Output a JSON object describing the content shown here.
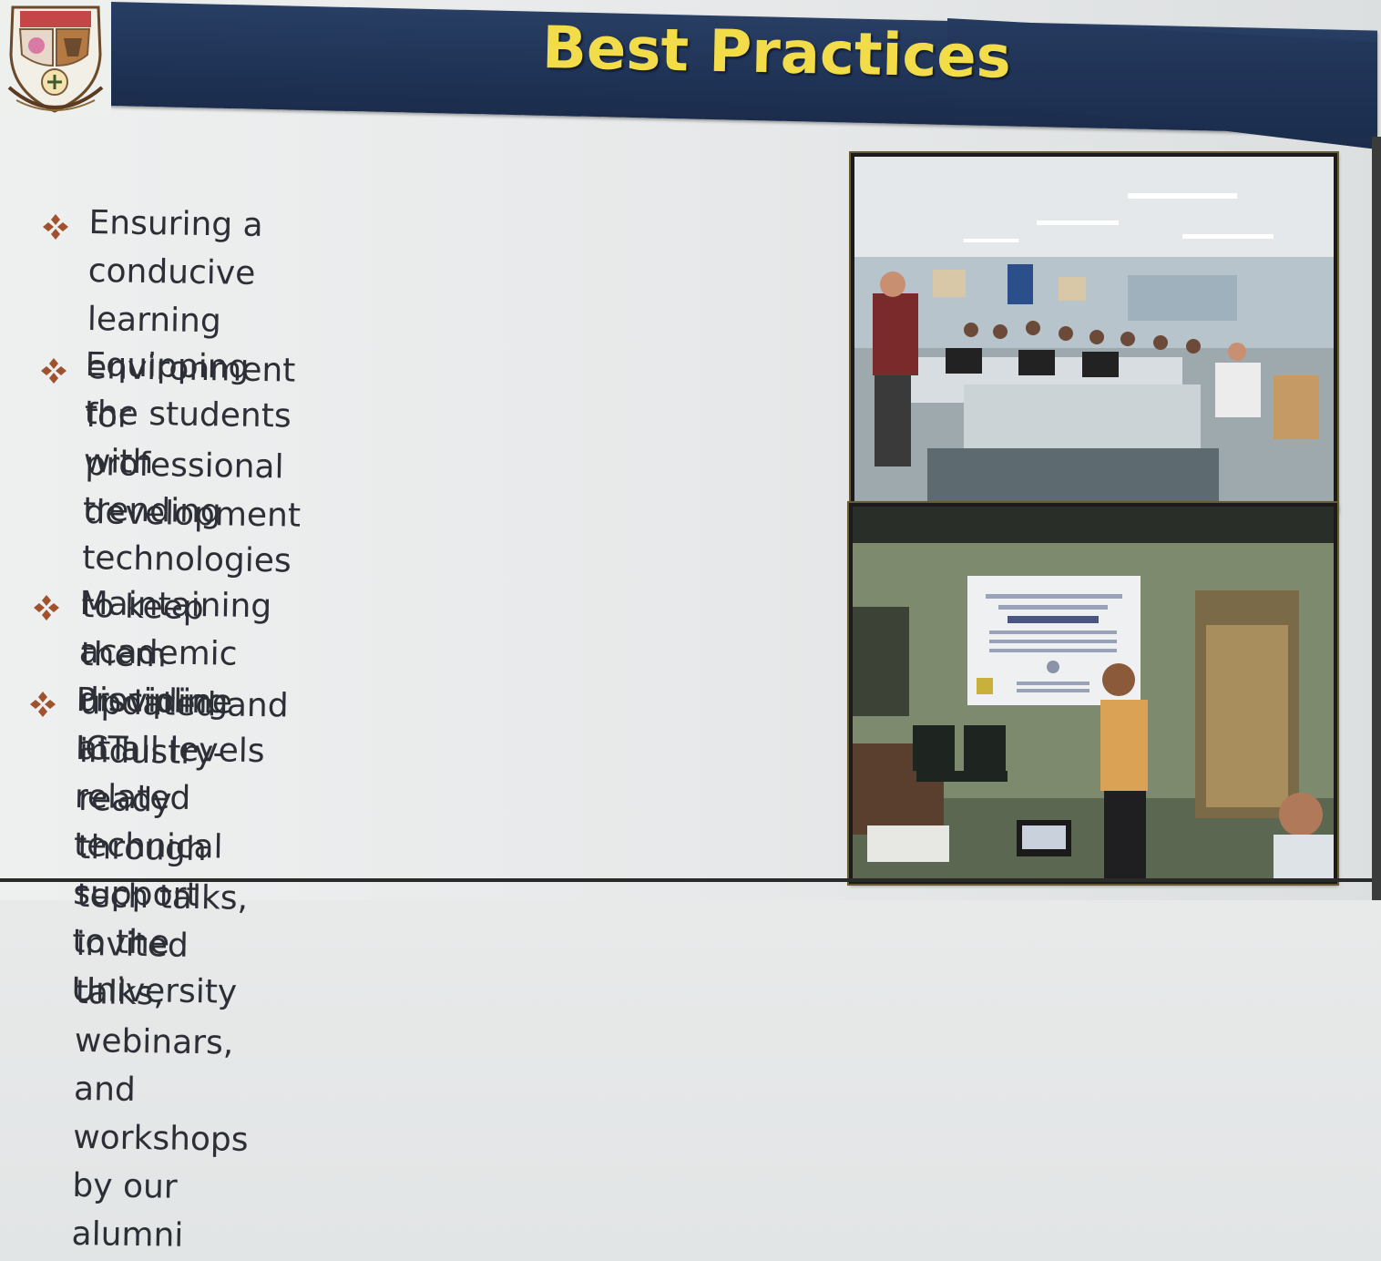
{
  "header": {
    "title": "Best Practices"
  },
  "colors": {
    "header_bar": "#1f3356",
    "title_text": "#f3dc4a",
    "bullet_marker": "#a0522d",
    "body_text": "#2d2f36"
  },
  "icons": {
    "emblem": "university-emblem-icon",
    "bullet": "four-diamond-bullet-icon"
  },
  "bullets": {
    "items": [
      {
        "line1": "Ensuring a conducive learning environment",
        "line2": "for professional development"
      },
      {
        "line1": "Equipping the students with trending",
        "line2": "technologies to keep them updated and",
        "line3": "industry-ready through tech talks, invited",
        "line4": "talks, webinars, and workshops by our alumni"
      },
      {
        "line1": "Maintaining academic discipline at all levels"
      },
      {
        "line1": "Providing ICT related technical support to the",
        "line2": "University"
      }
    ]
  },
  "photos": {
    "top_photo": "computer-lab-session-photo",
    "bottom_photo": "seminar-presentation-photo"
  }
}
